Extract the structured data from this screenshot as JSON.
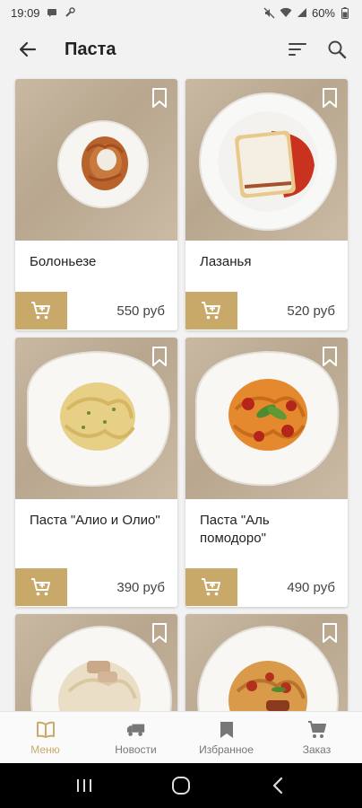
{
  "status": {
    "time": "19:09",
    "battery": "60%"
  },
  "header": {
    "title": "Паста"
  },
  "products": [
    {
      "name": "Болоньезе",
      "price": "550 руб"
    },
    {
      "name": "Лазанья",
      "price": "520 руб"
    },
    {
      "name": "Паста \"Алио и Олио\"",
      "price": "390 руб"
    },
    {
      "name": "Паста \"Аль помодоро\"",
      "price": "490 руб"
    }
  ],
  "nav": {
    "menu": "Меню",
    "news": "Новости",
    "favorites": "Избранное",
    "order": "Заказ"
  },
  "colors": {
    "accent": "#c9a96a",
    "background": "#f2f2f2"
  },
  "icons": [
    "back-arrow-icon",
    "sort-icon",
    "search-icon",
    "bookmark-icon",
    "add-to-cart-icon",
    "book-icon",
    "truck-icon",
    "bookmark-nav-icon",
    "cart-icon"
  ]
}
